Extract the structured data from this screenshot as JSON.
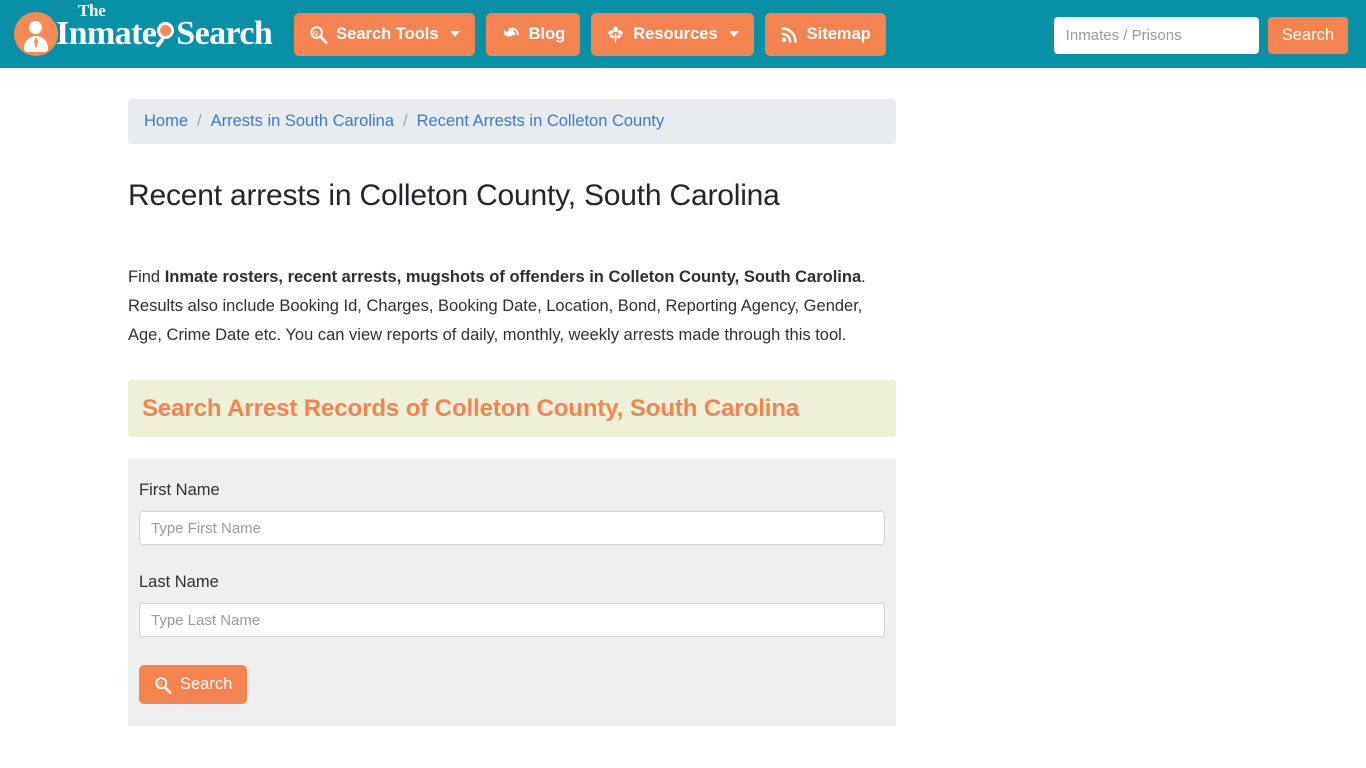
{
  "header": {
    "brand": {
      "the": "The",
      "word_one": "Inmate",
      "word_two": "Search",
      "logo_icon": "person-in-circle-icon",
      "glass_icon": "magnifier-icon"
    },
    "nav": [
      {
        "label": "Search Tools",
        "icon": "magnifier-icon",
        "has_caret": true
      },
      {
        "label": "Blog",
        "icon": "blogger-icon",
        "has_caret": false
      },
      {
        "label": "Resources",
        "icon": "leaf-icon",
        "has_caret": true
      },
      {
        "label": "Sitemap",
        "icon": "rss-icon",
        "has_caret": false
      }
    ],
    "search": {
      "placeholder": "Inmates / Prisons",
      "value": "",
      "button_label": "Search"
    },
    "bg_color": "#0790a6",
    "accent_color": "#f5834f"
  },
  "breadcrumb": [
    {
      "label": "Home"
    },
    {
      "label": "Arrests in South Carolina"
    },
    {
      "label": "Recent Arrests in Colleton County"
    }
  ],
  "breadcrumb_separator": "/",
  "main": {
    "page_title": "Recent arrests in Colleton County, South Carolina",
    "intro": {
      "lead": "Find ",
      "bold": "Inmate rosters, recent arrests, mugshots of offenders in Colleton County, South Carolina",
      "rest": ". Results also include Booking Id, Charges, Booking Date, Location, Bond, Reporting Agency, Gender, Age, Crime Date etc. You can view reports of daily, monthly, weekly arrests made through this tool."
    },
    "section_heading": "Search Arrest Records of Colleton County, South Carolina",
    "form": {
      "fields": [
        {
          "label": "First Name",
          "placeholder": "Type First Name",
          "value": ""
        },
        {
          "label": "Last Name",
          "placeholder": "Type Last Name",
          "value": ""
        }
      ],
      "submit_label": "Search",
      "submit_icon": "magnifier-icon"
    }
  }
}
